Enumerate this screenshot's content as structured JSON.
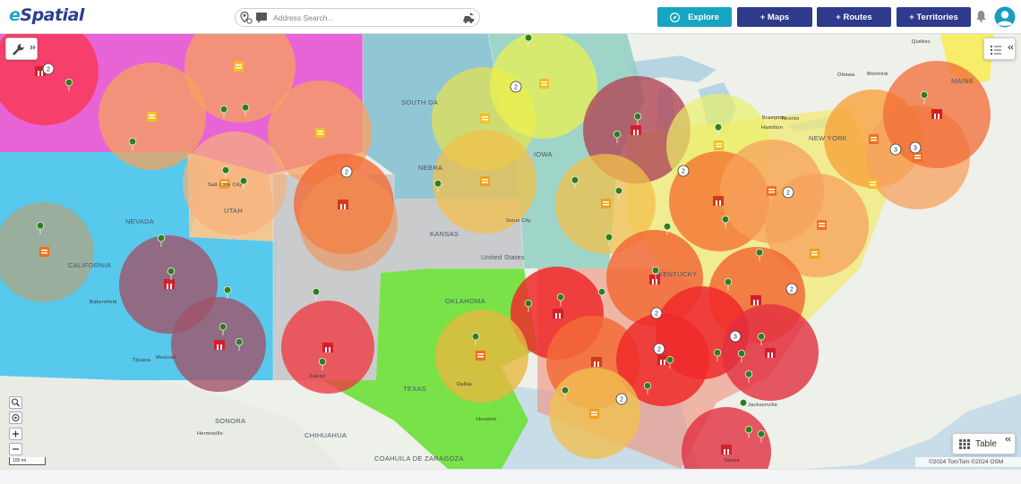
{
  "app": {
    "logo_e": "e",
    "logo_rest": "Spatial"
  },
  "search": {
    "placeholder": "Address Search..."
  },
  "toolbar": {
    "explore": "Explore",
    "maps": "+ Maps",
    "routes": "+ Routes",
    "territories": "+ Territories"
  },
  "map": {
    "table_label": "Table",
    "scale_label": "100 mi",
    "attribution": "©2024 TomTom ©2024 OSM",
    "region_labels": [
      "NEVADA",
      "CALIFORNIA",
      "UTAH",
      "KANSAS",
      "United States",
      "OKLAHOMA",
      "TEXAS",
      "IOWA",
      "SOUTH DA",
      "NEBRA",
      "SONORA",
      "CHIHUAHUA",
      "COAHUILA DE ZARAGOZA",
      "KENTUCKY",
      "NEW YORK",
      "MAINE"
    ],
    "city_labels": [
      "Salt Lake City",
      "Ottawa",
      "Montréal",
      "Québec",
      "Toronto",
      "Hamilton",
      "Brampton",
      "Sioux City",
      "Tijuana",
      "Mexicali",
      "Bakersfield",
      "Juárez",
      "Hermosillo",
      "Dallas",
      "Houston",
      "Tampa",
      "Jacksonville"
    ],
    "cluster_counts": [
      "2",
      "2",
      "2",
      "2",
      "3",
      "3",
      "2",
      "2",
      "2",
      "3",
      "2",
      "2"
    ],
    "colors": {
      "accent_teal": "#17a4c0",
      "brand_navy": "#2e3a8c",
      "marker_green": "#2f7d1f",
      "marker_red": "#d21f2a"
    }
  }
}
